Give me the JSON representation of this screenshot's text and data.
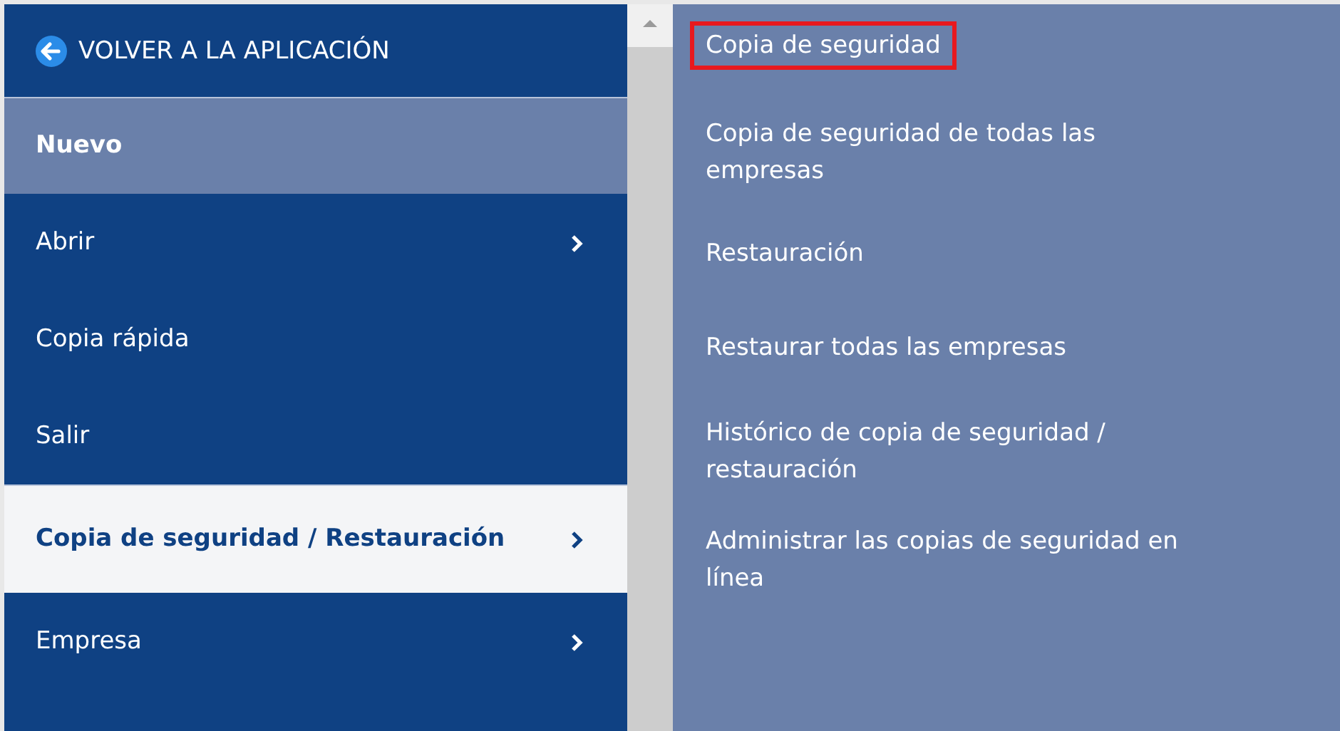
{
  "back_link": {
    "label": "VOLVER A LA APLICACIÓN"
  },
  "menu": [
    {
      "label": "Nuevo",
      "hovered": true,
      "selected": false,
      "has_submenu": false
    },
    {
      "label": "Abrir",
      "hovered": false,
      "selected": false,
      "has_submenu": true
    },
    {
      "label": "Copia rápida",
      "hovered": false,
      "selected": false,
      "has_submenu": false
    },
    {
      "label": "Salir",
      "hovered": false,
      "selected": false,
      "has_submenu": false
    },
    {
      "label": "Copia de seguridad / Restauración",
      "hovered": false,
      "selected": true,
      "has_submenu": true
    },
    {
      "label": "Empresa",
      "hovered": false,
      "selected": false,
      "has_submenu": true
    }
  ],
  "submenu": [
    {
      "label": "Copia de seguridad",
      "outlined": true
    },
    {
      "label": "Copia de seguridad de todas las empresas",
      "outlined": false
    },
    {
      "label": "Restauración",
      "outlined": false
    },
    {
      "label": "Restaurar todas las empresas",
      "outlined": false
    },
    {
      "label": "Histórico de copia de seguridad / restauración",
      "outlined": false
    },
    {
      "label": "Administrar las copias de seguridad en línea",
      "outlined": false
    }
  ]
}
